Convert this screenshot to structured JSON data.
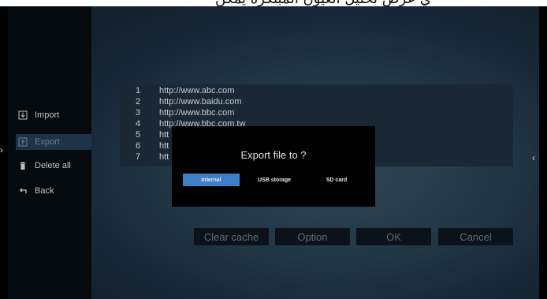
{
  "header": {
    "partial_text": "ي عرض تحليل العيون المبتكرة يمكن"
  },
  "sidebar": {
    "items": [
      {
        "label": "Import",
        "icon": "import-icon"
      },
      {
        "label": "Export",
        "icon": "export-icon"
      },
      {
        "label": "Delete all",
        "icon": "trash-icon"
      },
      {
        "label": "Back",
        "icon": "back-icon"
      }
    ],
    "selected": "Export"
  },
  "url_list": {
    "rows": [
      {
        "num": "1",
        "url": "http://www.abc.com"
      },
      {
        "num": "2",
        "url": "http://www.baidu.com"
      },
      {
        "num": "3",
        "url": "http://www.bbc.com"
      },
      {
        "num": "4",
        "url": "http://www.bbc.com.tw"
      },
      {
        "num": "5",
        "url": "htt"
      },
      {
        "num": "6",
        "url": "htt"
      },
      {
        "num": "7",
        "url": "htt"
      }
    ]
  },
  "dialog": {
    "title": "Export file to ?",
    "options": [
      {
        "label": "Internal",
        "selected": true
      },
      {
        "label": "USB storage",
        "selected": false
      },
      {
        "label": "SD card",
        "selected": false
      }
    ]
  },
  "buttons": {
    "clear_cache": "Clear cache",
    "option": "Option",
    "ok": "OK",
    "cancel": "Cancel"
  },
  "colors": {
    "accent": "#3d80c8",
    "sidebar_bg": "#050a0f",
    "dialog_bg": "#000000"
  }
}
